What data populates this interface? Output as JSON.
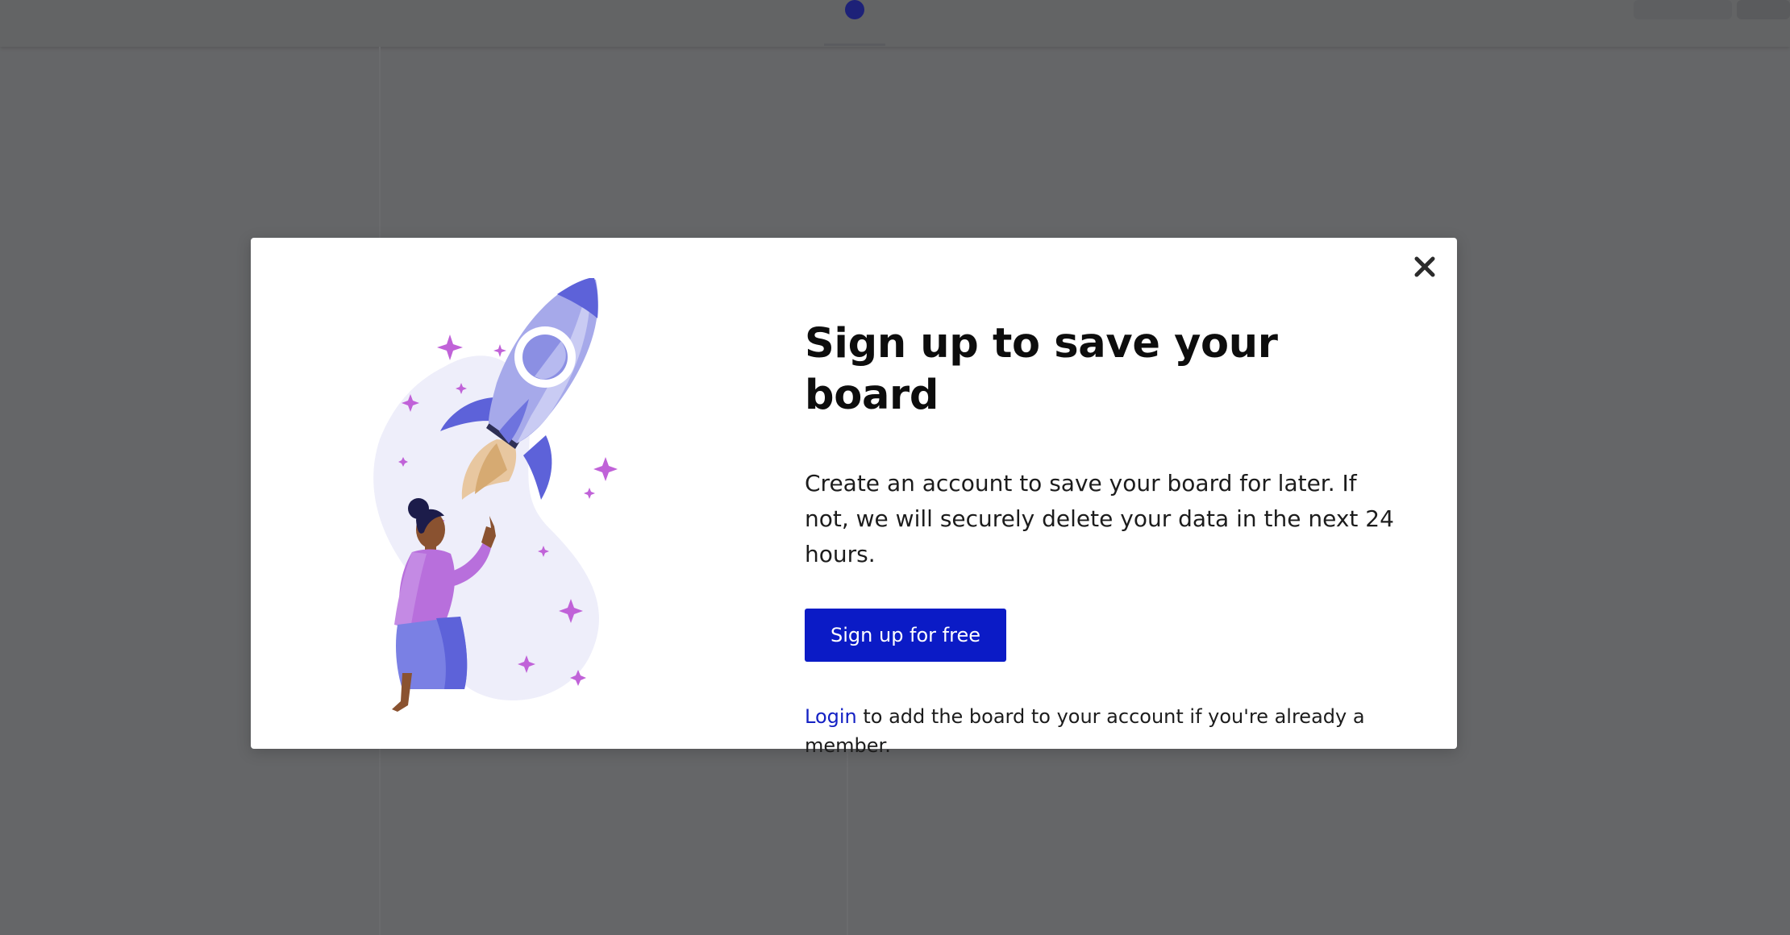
{
  "modal": {
    "title": "Sign up to save your board",
    "description": "Create an account to save your board for later. If not, we will securely delete your data in the next 24 hours.",
    "signup_button_label": "Sign up for free",
    "login_link_label": "Login",
    "login_suffix": " to add the board to your account if you're already a member.",
    "close_icon": "close-icon"
  },
  "illustration": {
    "subject": "rocket-launch-illustration",
    "colors": {
      "blob": "#eeeefa",
      "rocket_body": "#a6a9ea",
      "rocket_fin": "#5d62d9",
      "flame": "#e8c7a0",
      "sparkle": "#c062d8",
      "shirt": "#b86fdc",
      "skirt": "#7a80e4",
      "skin": "#8a5230",
      "hair": "#1c1c4a"
    }
  },
  "colors": {
    "overlay": "#656668",
    "primary_button": "#0b1bc6",
    "link": "#1421c4",
    "title_text": "#0d0d0d"
  }
}
